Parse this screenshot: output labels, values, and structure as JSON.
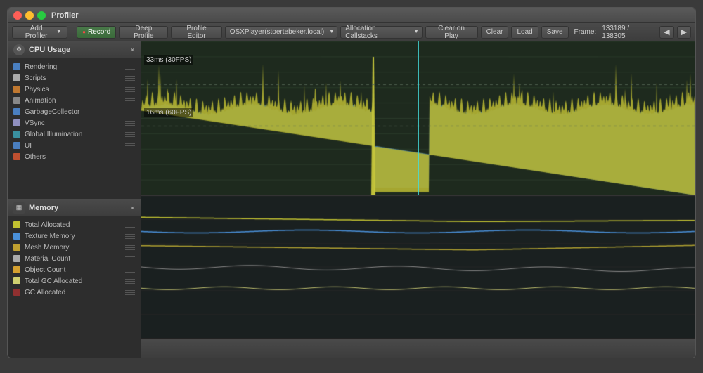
{
  "window": {
    "title": "Profiler"
  },
  "titlebar": {
    "title": "Profiler",
    "close_label": "×",
    "min_label": "−",
    "max_label": "+"
  },
  "toolbar": {
    "add_profiler_label": "Add Profiler",
    "record_label": "Record",
    "deep_profile_label": "Deep Profile",
    "profile_editor_label": "Profile Editor",
    "target_dropdown": "OSXPlayer(stoertebeker.local)",
    "allocation_dropdown": "Allocation Callstacks",
    "clear_on_play_label": "Clear on Play",
    "clear_label": "Clear",
    "load_label": "Load",
    "save_label": "Save",
    "frame_label": "Frame:",
    "frame_value": "133189 / 138305",
    "prev_label": "◀",
    "next_label": "▶"
  },
  "cpu_panel": {
    "title": "CPU Usage",
    "close_label": "×",
    "label_33ms": "33ms (30FPS)",
    "label_16ms": "16ms (60FPS)",
    "legend": [
      {
        "label": "Rendering",
        "color": "#4a90d9"
      },
      {
        "label": "Scripts",
        "color": "#b0b0b0"
      },
      {
        "label": "Physics",
        "color": "#d4a030"
      },
      {
        "label": "Animation",
        "color": "#7a7a7a"
      },
      {
        "label": "GarbageCollector",
        "color": "#4a90d9"
      },
      {
        "label": "VSync",
        "color": "#b0b0b0"
      },
      {
        "label": "Global Illumination",
        "color": "#4a90d9"
      },
      {
        "label": "UI",
        "color": "#4a90d9"
      },
      {
        "label": "Others",
        "color": "#b05030"
      }
    ]
  },
  "memory_panel": {
    "title": "Memory",
    "close_label": "×",
    "legend": [
      {
        "label": "Total Allocated",
        "color": "#b0b030"
      },
      {
        "label": "Texture Memory",
        "color": "#4a90d9"
      },
      {
        "label": "Mesh Memory",
        "color": "#b0b030"
      },
      {
        "label": "Material Count",
        "color": "#aaaaaa"
      },
      {
        "label": "Object Count",
        "color": "#d4a030"
      },
      {
        "label": "Total GC Allocated",
        "color": "#c0c070"
      },
      {
        "label": "GC Allocated",
        "color": "#9a2020"
      }
    ]
  },
  "bottom": {
    "text": ""
  }
}
